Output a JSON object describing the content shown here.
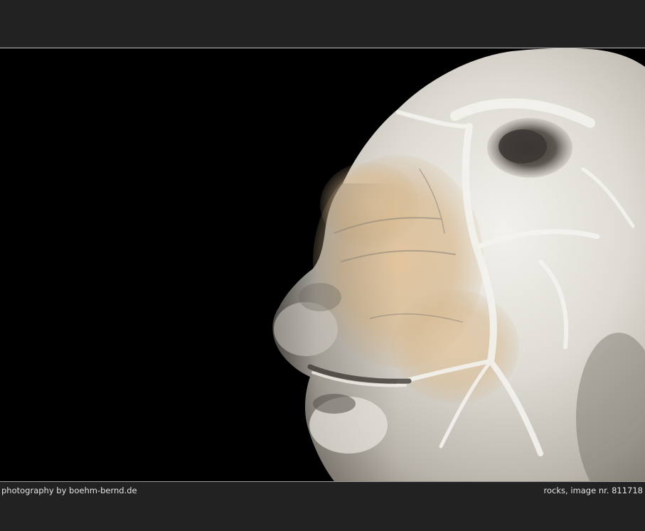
{
  "photo": {
    "subject_icon": "rock-head-photo-icon",
    "colors": {
      "page_background": "#222222",
      "photo_background": "#000000",
      "rock_light": "#e8e6e1",
      "rock_warm": "#d8b88c",
      "rock_shadow": "#5a554e",
      "caption_text": "#e6e6e6"
    }
  },
  "footer": {
    "credit": "photography by boehm-bernd.de",
    "image_info": "rocks, image nr. 811718"
  }
}
